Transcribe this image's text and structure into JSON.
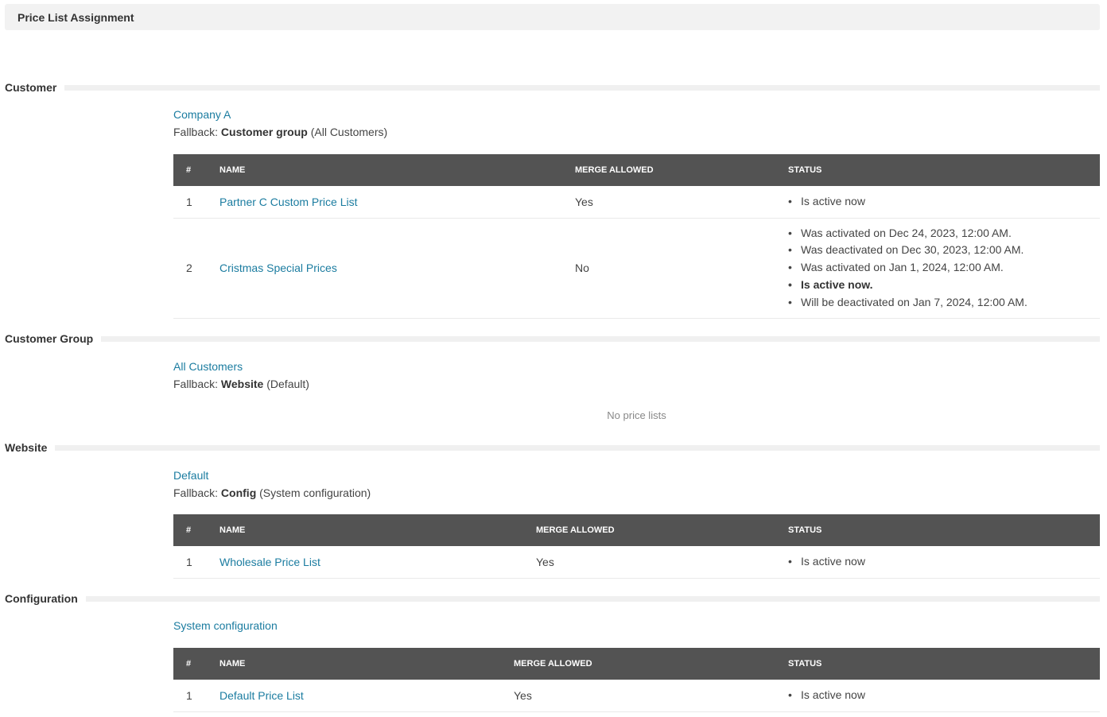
{
  "header": {
    "title": "Price List Assignment"
  },
  "columns": {
    "num": "#",
    "name": "NAME",
    "merge": "MERGE ALLOWED",
    "status": "STATUS"
  },
  "customer": {
    "section_label": "Customer",
    "entity": "Company A",
    "fallback_prefix": "Fallback:",
    "fallback_bold": "Customer group",
    "fallback_rest": "(All Customers)",
    "rows": [
      {
        "num": "1",
        "name": "Partner C Custom Price List",
        "merge": "Yes",
        "status": [
          "Is active now"
        ]
      },
      {
        "num": "2",
        "name": "Cristmas Special Prices",
        "merge": "No",
        "status": [
          "Was activated on Dec 24, 2023, 12:00 AM.",
          "Was deactivated on Dec 30, 2023, 12:00 AM.",
          "Was activated on Jan 1, 2024, 12:00 AM.",
          "Is active now.",
          "Will be deactivated on Jan 7, 2024, 12:00 AM."
        ]
      }
    ]
  },
  "customer_group": {
    "section_label": "Customer Group",
    "entity": "All Customers",
    "fallback_prefix": "Fallback:",
    "fallback_bold": "Website",
    "fallback_rest": "(Default)",
    "empty_text": "No price lists"
  },
  "website": {
    "section_label": "Website",
    "entity": "Default",
    "fallback_prefix": "Fallback:",
    "fallback_bold": "Config",
    "fallback_rest": "(System configuration)",
    "rows": [
      {
        "num": "1",
        "name": "Wholesale Price List",
        "merge": "Yes",
        "status": [
          "Is active now"
        ]
      }
    ]
  },
  "configuration": {
    "section_label": "Configuration",
    "entity": "System configuration",
    "rows": [
      {
        "num": "1",
        "name": "Default Price List",
        "merge": "Yes",
        "status": [
          "Is active now"
        ]
      }
    ]
  }
}
